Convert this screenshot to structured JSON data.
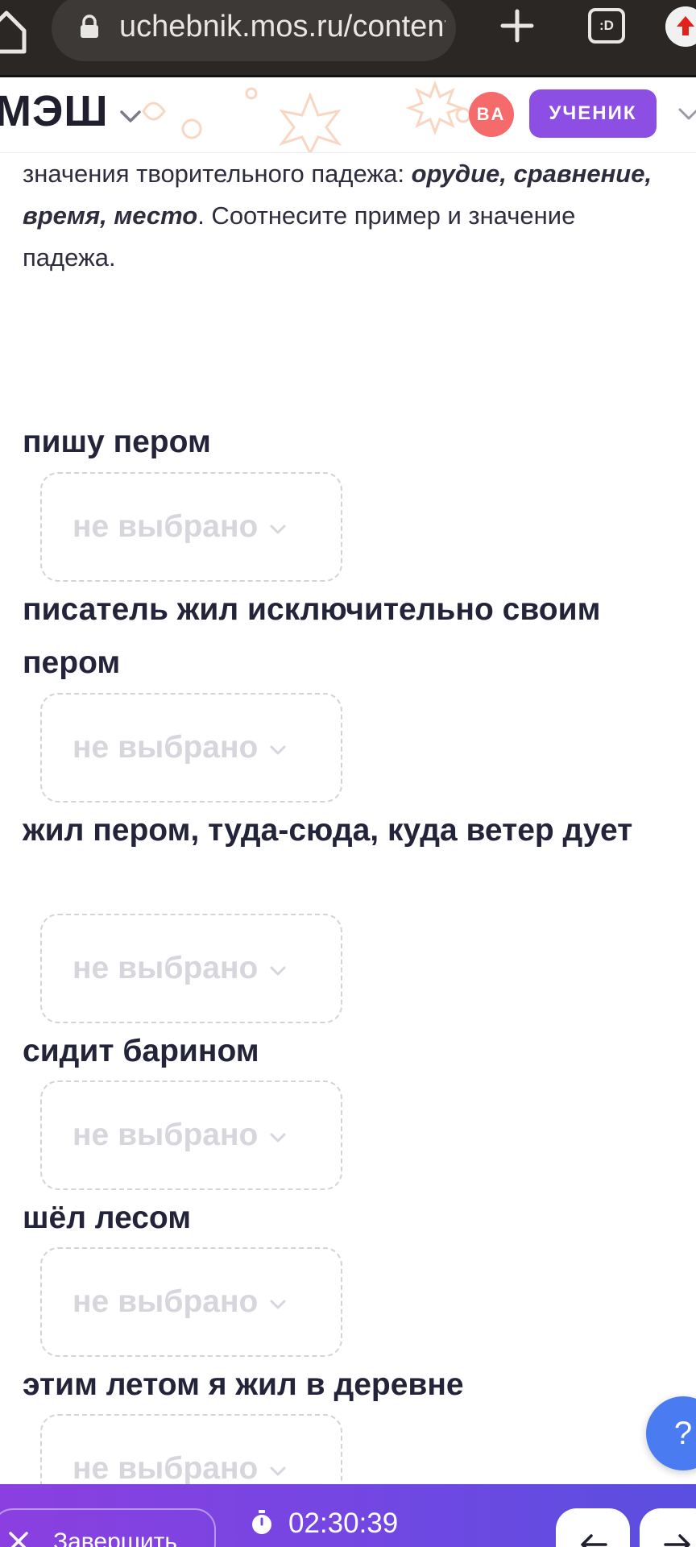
{
  "browser": {
    "url": "uchebnik.mos.ru/content/",
    "tabs_icon_label": ":D"
  },
  "header": {
    "logo": "МЭШ",
    "avatar_initials": "ВА",
    "role": "УЧЕНИК"
  },
  "instruction": {
    "part1": "значения творительного падежа: ",
    "bold": "орудие, сравнение, время, место",
    "part2": ". Соотнесите пример и значение падежа."
  },
  "questions": [
    {
      "text": "пишу пером",
      "selected": "не выбрано"
    },
    {
      "text": "писатель жил исключительно своим пером",
      "selected": "не выбрано"
    },
    {
      "text": "жил пером, туда-сюда, куда ветер дует",
      "selected": "не выбрано"
    },
    {
      "text": "сидит барином",
      "selected": "не выбрано"
    },
    {
      "text": "шёл лесом",
      "selected": "не выбрано"
    },
    {
      "text": "этим летом я жил в деревне",
      "selected": "не выбрано"
    }
  ],
  "help_label": "?",
  "footer": {
    "finish_label": "Завершить",
    "timer": "02:30:39"
  },
  "colors": {
    "accent": "#8d4fe3",
    "avatar": "#f56a6a",
    "help": "#4a7bf0"
  }
}
